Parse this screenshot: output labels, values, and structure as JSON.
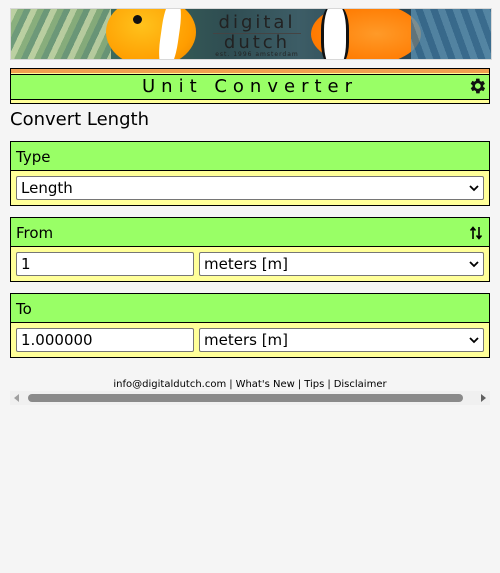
{
  "banner": {
    "logo_line1": "digital",
    "logo_line2": "dutch",
    "logo_tagline": "est. 1996 amsterdam"
  },
  "app": {
    "title": "Unit Converter",
    "heading": "Convert Length"
  },
  "type_panel": {
    "label": "Type",
    "selected": "Length"
  },
  "from_panel": {
    "label": "From",
    "value": "1",
    "unit": "meters [m]"
  },
  "to_panel": {
    "label": "To",
    "value": "1.000000",
    "unit": "meters [m]"
  },
  "footer": {
    "links": [
      "info@digitaldutch.com",
      "What's New",
      "Tips",
      "Disclaimer"
    ],
    "separator": "|"
  },
  "colors": {
    "panel_header": "#99ff66",
    "panel_body": "#ffff99",
    "title_accent": "#f0a050"
  },
  "icons": {
    "settings": "gear-icon",
    "swap": "swap-arrows-icon",
    "dropdown": "chevron-down-icon"
  }
}
